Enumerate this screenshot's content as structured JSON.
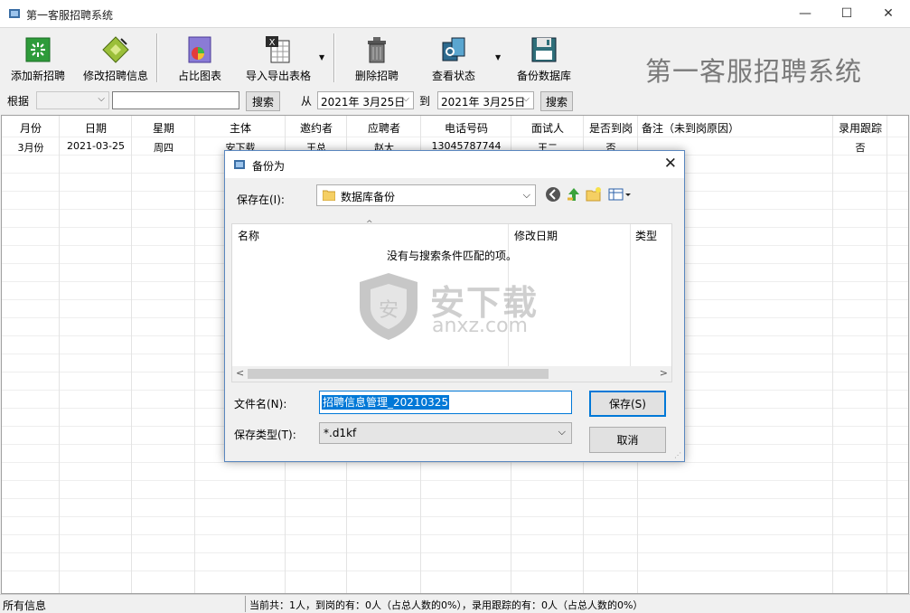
{
  "window": {
    "title": "第一客服招聘系统",
    "min_glyph": "—",
    "max_glyph": "☐",
    "close_glyph": "✕"
  },
  "toolbar": {
    "buttons": [
      {
        "label": "添加新招聘",
        "icon": "add-recruit-icon"
      },
      {
        "label": "修改招聘信息",
        "icon": "edit-recruit-icon"
      },
      {
        "label": "占比图表",
        "icon": "chart-icon"
      },
      {
        "label": "导入导出表格",
        "icon": "import-export-icon"
      },
      {
        "label": "删除招聘",
        "icon": "trash-icon"
      },
      {
        "label": "查看状态",
        "icon": "status-icon"
      },
      {
        "label": "备份数据库",
        "icon": "floppy-disk-icon"
      }
    ],
    "brand": "第一客服招聘系统",
    "dropdown_glyph": "▼"
  },
  "filter": {
    "by_label": "根据",
    "by_value": "",
    "keyword_value": "",
    "search1_label": "搜索",
    "from_label": "从",
    "from_date": "2021年  3月25日",
    "to_label": "到",
    "to_date": "2021年  3月25日",
    "search2_label": "搜索",
    "arrow_glyph": "⌵"
  },
  "table": {
    "columns": [
      "月份",
      "日期",
      "星期",
      "主体",
      "邀约者",
      "应聘者",
      "电话号码",
      "面试人",
      "是否到岗",
      "备注（未到岗原因）",
      "录用跟踪"
    ],
    "rows": [
      [
        "3月份",
        "2021-03-25",
        "周四",
        "安下载",
        "王总",
        "赵大",
        "13045787744",
        "王二",
        "否",
        "",
        "否"
      ]
    ]
  },
  "status": {
    "left": "所有信息",
    "right": "当前共：1人，到岗的有：0人（占总人数的0%），录用跟踪的有：0人（占总人数的0%）"
  },
  "dialog": {
    "title": "备份为",
    "close_glyph": "✕",
    "save_in_label": "保存在(I):",
    "location": "数据库备份",
    "list_headers": {
      "name": "名称",
      "modified": "修改日期",
      "type": "类型"
    },
    "sort_glyph": "^",
    "empty_message": "没有与搜索条件匹配的项。",
    "scroll_left": "<",
    "scroll_right": ">",
    "filename_label": "文件名(N):",
    "filename_value": "招聘信息管理_20210325",
    "filetype_label": "保存类型(T):",
    "filetype_value": "*.d1kf",
    "save_button": "保存(S)",
    "cancel_button": "取消",
    "arrow_glyph": "⌵"
  },
  "watermark": {
    "text": "安下载",
    "sub": "anxz.com"
  }
}
